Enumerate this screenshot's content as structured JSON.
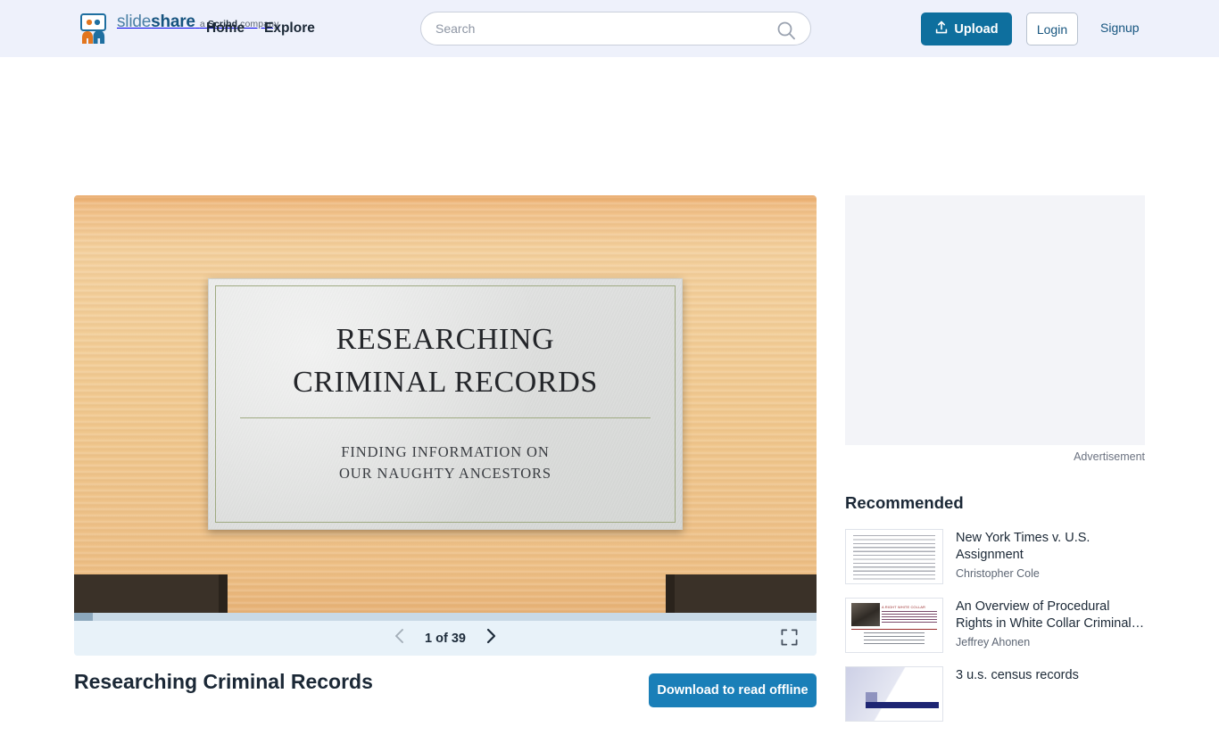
{
  "header": {
    "logo": {
      "word_light": "slide",
      "word_bold": "share",
      "tagline_prefix": "a ",
      "tagline_bold": "Scribd",
      "tagline_suffix": " company",
      "tagline_full": "a Scribd company"
    },
    "nav": [
      {
        "label": "Home"
      },
      {
        "label": "Explore"
      }
    ],
    "search": {
      "placeholder": "Search",
      "value": "",
      "icon": "search-icon"
    },
    "upload_button": {
      "label": "Upload",
      "icon": "upload-icon",
      "color": "#0e6f9e"
    },
    "login_button": {
      "label": "Login"
    },
    "signup_link": {
      "label": "Signup"
    },
    "background_color": "#eef1fb"
  },
  "player": {
    "slide": {
      "title_line1": "RESEARCHING",
      "title_line2": "CRIMINAL RECORDS",
      "subtitle_line1": "FINDING INFORMATION ON",
      "subtitle_line2": "OUR NAUGHTY ANCESTORS",
      "background": "wood-grain",
      "plaque_color": "#e0e1e0",
      "accent_color": "#9faa82",
      "ribbon_color": "#3a3128"
    },
    "controls": {
      "prev_label": "Previous slide",
      "next_label": "Next slide",
      "page_indicator": "1 of 39",
      "current_page": 1,
      "total_pages": 39,
      "fullscreen_label": "Fullscreen",
      "progress_percent": 2.6
    }
  },
  "deck": {
    "title": "Researching Criminal Records",
    "download_button": {
      "label": "Download to read offline",
      "color": "#1a7fb8"
    }
  },
  "right_rail": {
    "advertisement_label": "Advertisement",
    "recommended_heading": "Recommended",
    "recommended": [
      {
        "title": "New York Times v. U.S. Assignment",
        "author": "Christopher Cole",
        "thumb": "text-document"
      },
      {
        "title": "An Overview of Procedural Rights in White Collar Criminal…",
        "author": "Jeffrey Ahonen",
        "thumb": "white-collar-slide",
        "thumb_heading": "A RIGHT WHITE COLLAR"
      },
      {
        "title": "3 u.s. census records",
        "author": "",
        "thumb": "census-slide"
      }
    ]
  }
}
